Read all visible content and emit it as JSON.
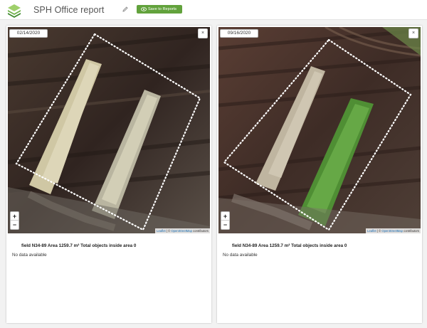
{
  "header": {
    "title": "SPH Office report",
    "save_label": "Save to Reports"
  },
  "panels": [
    {
      "date": "02/14/2020",
      "close": "×",
      "zoom_in": "+",
      "zoom_out": "−",
      "attribution": {
        "leaflet": "Leaflet",
        "sep": " | © ",
        "osm": "OpenStreetMap",
        "suffix": " contributors"
      },
      "info": "field N34-89 Area 1259.7 m² Total objects inside area 0",
      "status": "No data available"
    },
    {
      "date": "09/16/2020",
      "close": "×",
      "zoom_in": "+",
      "zoom_out": "−",
      "attribution": {
        "leaflet": "Leaflet",
        "sep": " | © ",
        "osm": "OpenStreetMap",
        "suffix": " contributors"
      },
      "info": "field N34-89 Area 1259.7 m² Total objects inside area 0",
      "status": "No data available"
    }
  ],
  "colors": {
    "accent": "#62a23c",
    "soil": "#3a2c25",
    "sand": "#d6cfb0",
    "vegetation": "#5a9a3a"
  },
  "icons": [
    "layers-logo-icon",
    "pencil-icon",
    "eye-icon",
    "close-icon"
  ]
}
